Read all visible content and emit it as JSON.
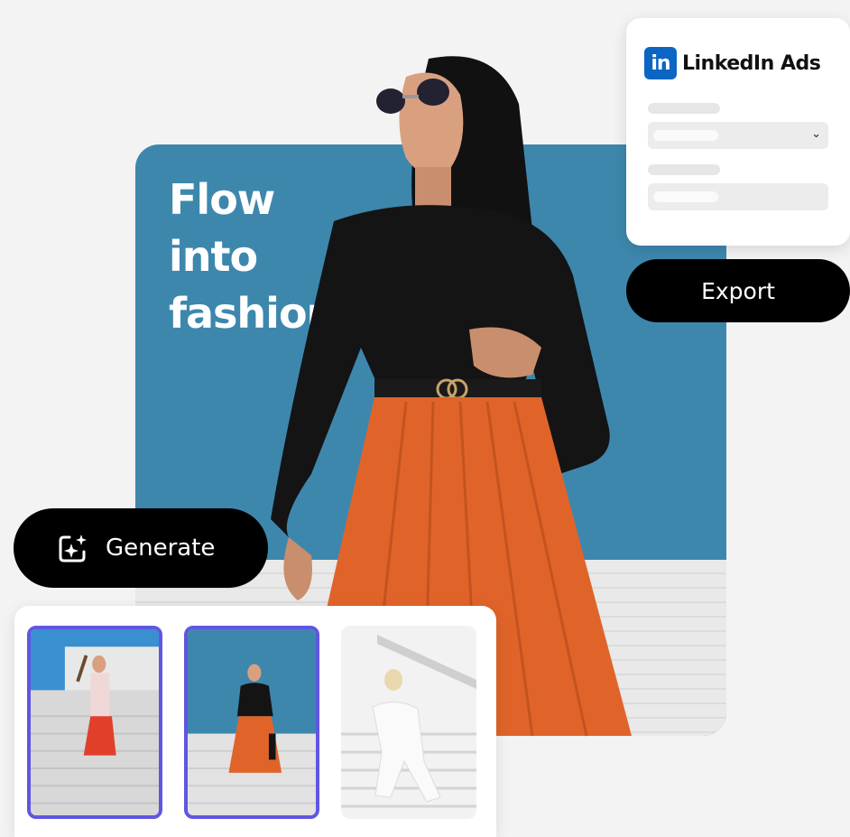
{
  "hero": {
    "headline_lines": [
      "Flow",
      "into",
      "fashion."
    ]
  },
  "linkedin": {
    "logo_text": "in",
    "title": "LinkedIn Ads"
  },
  "buttons": {
    "export_label": "Export",
    "generate_label": "Generate"
  },
  "variations": [
    {
      "selected": true
    },
    {
      "selected": true
    },
    {
      "selected": false
    }
  ],
  "colors": {
    "hero_blue": "#3d87ad",
    "skirt_orange": "#e0642a",
    "linkedin_blue": "#0a66c2",
    "selection_purple": "#6056e0"
  }
}
